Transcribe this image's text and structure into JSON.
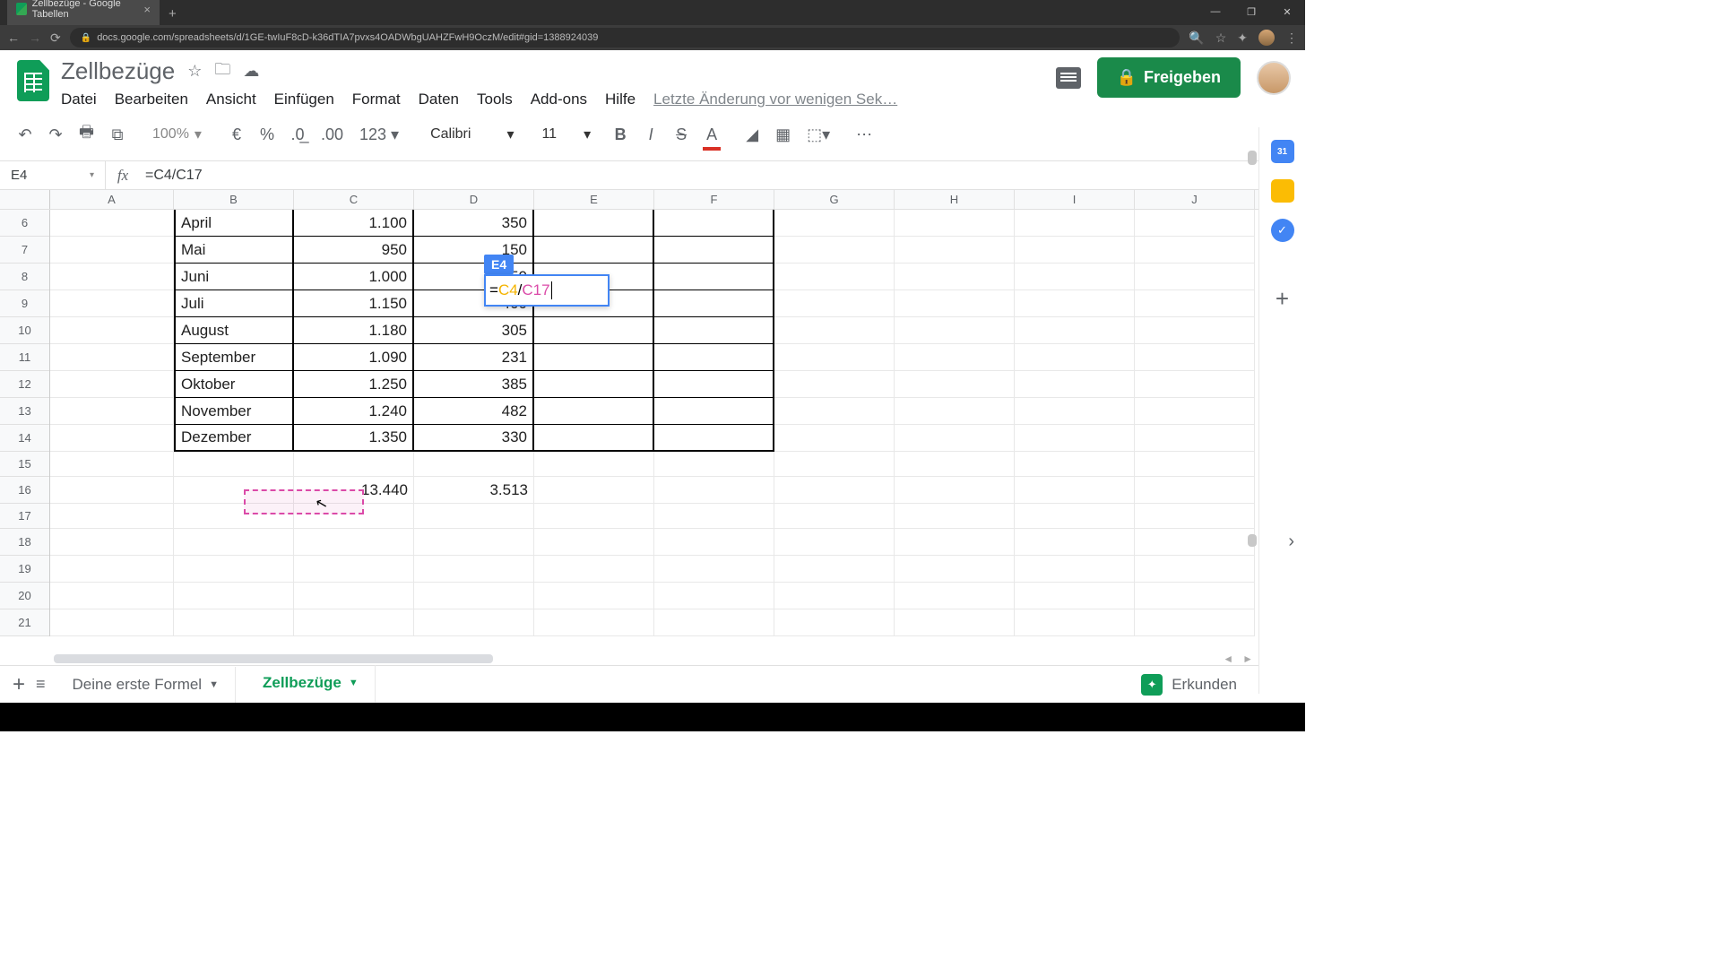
{
  "browser": {
    "tab_title": "Zellbezüge - Google Tabellen",
    "url": "docs.google.com/spreadsheets/d/1GE-twIuF8cD-k36dTIA7pvxs4OADWbgUAHZFwH9OczM/edit#gid=1388924039"
  },
  "doc": {
    "title": "Zellbezüge",
    "status": "Letzte Änderung vor wenigen Sek…"
  },
  "menu": {
    "file": "Datei",
    "edit": "Bearbeiten",
    "view": "Ansicht",
    "insert": "Einfügen",
    "format": "Format",
    "data": "Daten",
    "tools": "Tools",
    "addons": "Add-ons",
    "help": "Hilfe"
  },
  "toolbar": {
    "zoom": "100%",
    "currency": "€",
    "percent": "%",
    "dec_less": ".0",
    "dec_more": ".00",
    "num_format": "123",
    "font": "Calibri",
    "font_size": "11"
  },
  "share_label": "Freigeben",
  "namebox": "E4",
  "formula": "=C4/C17",
  "editing": {
    "label": "E4",
    "eq": "=",
    "ref1": "C4",
    "op": "/",
    "ref2": "C17"
  },
  "cols": [
    "A",
    "B",
    "C",
    "D",
    "E",
    "F",
    "G",
    "H",
    "I",
    "J"
  ],
  "row_nums": [
    "6",
    "7",
    "8",
    "9",
    "10",
    "11",
    "12",
    "13",
    "14",
    "15",
    "16",
    "17",
    "18",
    "19",
    "20",
    "21"
  ],
  "rows": [
    {
      "b": "April",
      "c": "1.100",
      "d": "350"
    },
    {
      "b": "Mai",
      "c": "950",
      "d": "150"
    },
    {
      "b": "Juni",
      "c": "1.000",
      "d": "350"
    },
    {
      "b": "Juli",
      "c": "1.150",
      "d": "400"
    },
    {
      "b": "August",
      "c": "1.180",
      "d": "305"
    },
    {
      "b": "September",
      "c": "1.090",
      "d": "231"
    },
    {
      "b": "Oktober",
      "c": "1.250",
      "d": "385"
    },
    {
      "b": "November",
      "c": "1.240",
      "d": "482"
    },
    {
      "b": "Dezember",
      "c": "1.350",
      "d": "330"
    }
  ],
  "totals": {
    "c": "13.440",
    "d": "3.513"
  },
  "sheets": {
    "tab1": "Deine erste Formel",
    "tab2": "Zellbezüge"
  },
  "explore": "Erkunden"
}
